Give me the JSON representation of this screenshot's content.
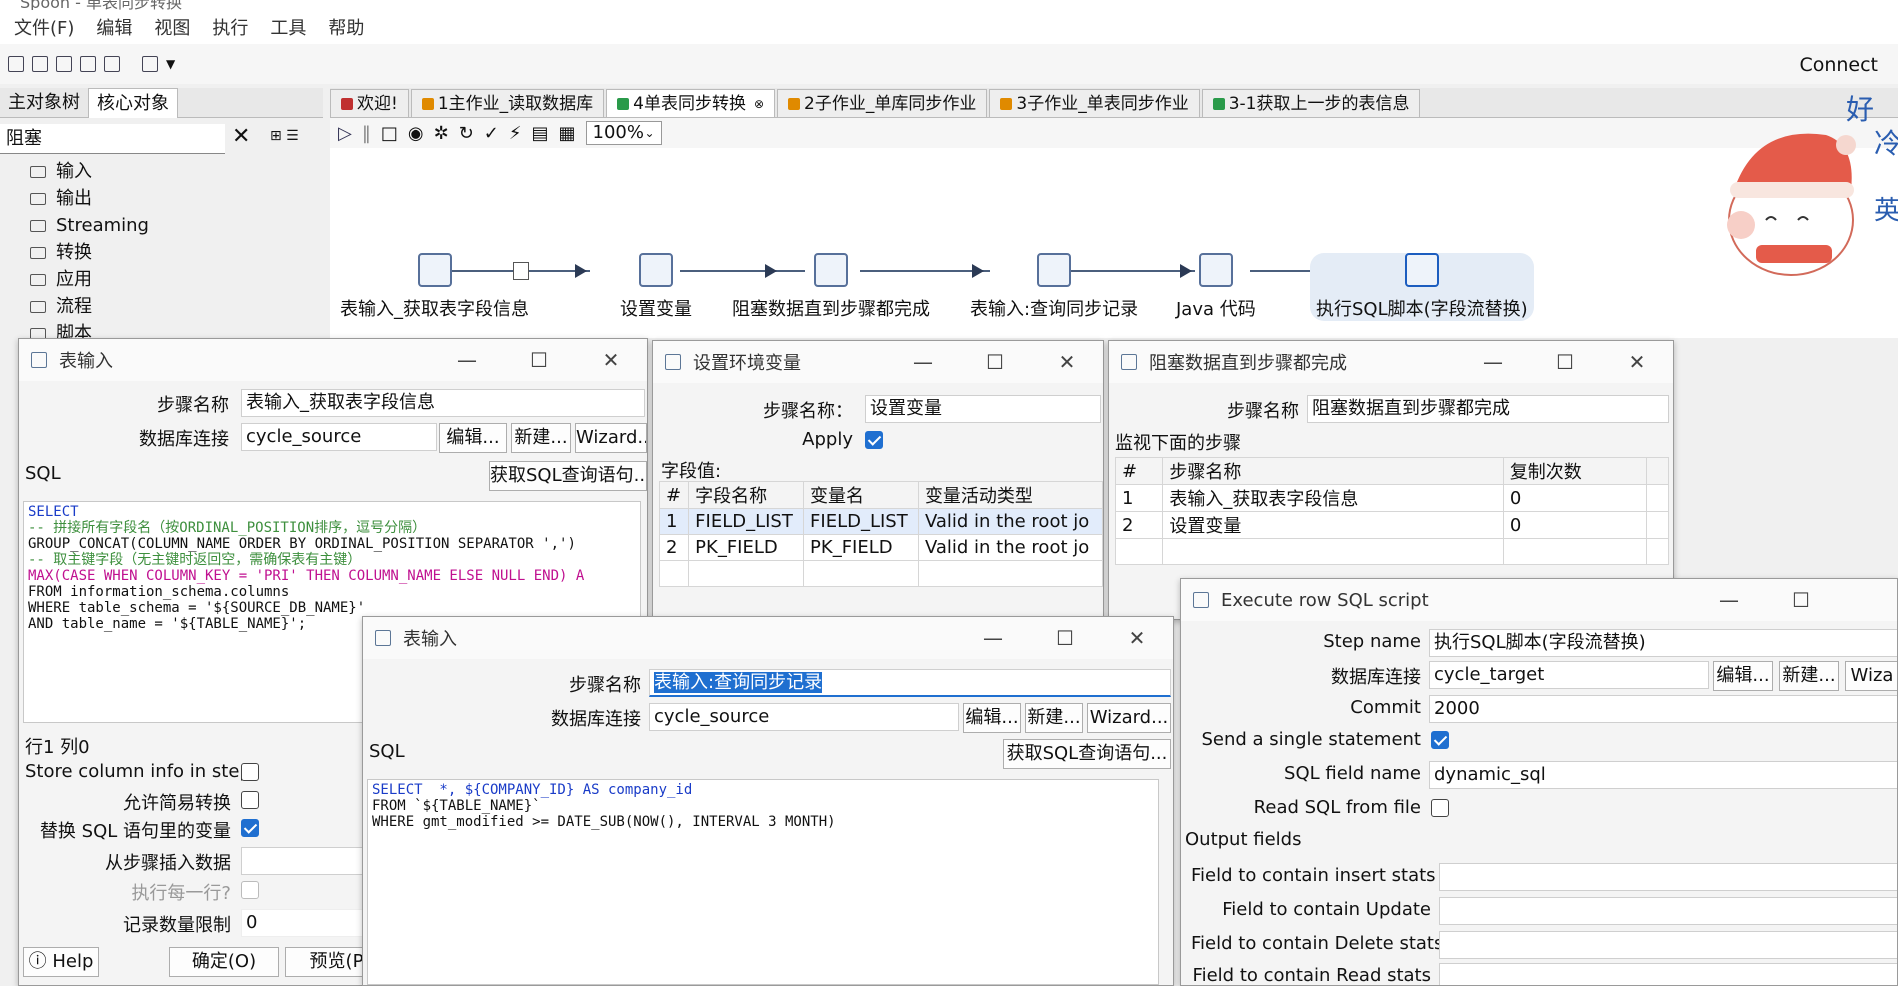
{
  "app": {
    "title": "Spoon - 单表同步转换",
    "connect_label": "Connect"
  },
  "menu": [
    "文件(F)",
    "编辑",
    "视图",
    "执行",
    "工具",
    "帮助"
  ],
  "left_panel": {
    "tabs": [
      "主对象树",
      "核心对象"
    ],
    "search_value": "阻塞",
    "tree": [
      "输入",
      "输出",
      "Streaming",
      "转换",
      "应用",
      "流程",
      "脚本"
    ]
  },
  "tabs": [
    {
      "label": "欢迎!",
      "color": "#c03030"
    },
    {
      "label": "1主作业_读取数据库",
      "color": "#e08a00"
    },
    {
      "label": "4单表同步转换",
      "color": "#2a9a4a"
    },
    {
      "label": "2子作业_单库同步作业",
      "color": "#e08a00"
    },
    {
      "label": "3子作业_单表同步作业",
      "color": "#e08a00"
    },
    {
      "label": "3-1获取上一步的表信息",
      "color": "#2a9a4a"
    }
  ],
  "canvas": {
    "zoom": "100%",
    "nodes": [
      "表输入_获取表字段信息",
      "设置变量",
      "阻塞数据直到步骤都完成",
      "表输入:查询同步记录",
      "Java 代码",
      "执行SQL脚本(字段流替换)"
    ]
  },
  "dialog1": {
    "title": "表输入",
    "step_name_label": "步骤名称",
    "step_name": "表输入_获取表字段信息",
    "conn_label": "数据库连接",
    "conn": "cycle_source",
    "edit_btn": "编辑...",
    "new_btn": "新建...",
    "wizard_btn": "Wizard...",
    "sql_label": "SQL",
    "get_sql_btn": "获取SQL查询语句...",
    "sql_lines": [
      "SELECT",
      "-- 拼接所有字段名（按ORDINAL_POSITION排序，逗号分隔）",
      "GROUP_CONCAT(COLUMN_NAME ORDER BY ORDINAL_POSITION SEPARATOR ',')",
      "-- 取主键字段（无主键时返回空，需确保表有主键）",
      "MAX(CASE WHEN COLUMN_KEY = 'PRI' THEN COLUMN_NAME ELSE NULL END) A",
      "FROM information_schema.columns",
      "WHERE table_schema = '${SOURCE_DB_NAME}'",
      "AND table_name = '${TABLE_NAME}';"
    ],
    "pos_text": "行1 列0",
    "store_col_label": "Store column info in step",
    "lazy_label": "允许简易转换",
    "replace_var_label": "替换 SQL 语句里的变量",
    "insert_from_label": "从步骤插入数据",
    "exec_each_label": "执行每一行?",
    "limit_label": "记录数量限制",
    "limit_value": "0",
    "help_btn": "Help",
    "ok_btn": "确定(O)",
    "preview_btn": "预览(P)"
  },
  "dialog2": {
    "title": "设置环境变量",
    "step_name_label": "步骤名称：",
    "step_name": "设置变量",
    "apply_label": "Apply",
    "fields_label": "字段值:",
    "columns": [
      "#",
      "字段名称",
      "变量名",
      "变量活动类型"
    ],
    "rows": [
      [
        "1",
        "FIELD_LIST",
        "FIELD_LIST",
        "Valid in the root jo"
      ],
      [
        "2",
        "PK_FIELD",
        "PK_FIELD",
        "Valid in the root jo"
      ]
    ]
  },
  "dialog3": {
    "title": "阻塞数据直到步骤都完成",
    "step_name_label": "步骤名称",
    "step_name": "阻塞数据直到步骤都完成",
    "watch_label": "监视下面的步骤",
    "columns": [
      "#",
      "步骤名称",
      "复制次数"
    ],
    "rows": [
      [
        "1",
        "表输入_获取表字段信息",
        "0"
      ],
      [
        "2",
        "设置变量",
        "0"
      ]
    ]
  },
  "dialog4": {
    "title": "Execute row SQL script",
    "step_name_label": "Step name",
    "step_name": "执行SQL脚本(字段流替换)",
    "conn_label": "数据库连接",
    "conn": "cycle_target",
    "edit_btn": "编辑...",
    "new_btn": "新建...",
    "wizard_btn": "Wiza",
    "commit_label": "Commit",
    "commit": "2000",
    "single_label": "Send a single statement",
    "sql_field_label": "SQL field name",
    "sql_field": "dynamic_sql",
    "read_file_label": "Read SQL from file",
    "output_label": "Output fields",
    "insert_label": "Field to contain insert stats",
    "update_label": "Field to contain Update",
    "delete_label": "Field to contain Delete stats",
    "read_label": "Field to contain Read stats"
  },
  "dialog5": {
    "title": "表输入",
    "step_name_label": "步骤名称",
    "step_name": "表输入:查询同步记录",
    "conn_label": "数据库连接",
    "conn": "cycle_source",
    "edit_btn": "编辑...",
    "new_btn": "新建...",
    "wizard_btn": "Wizard...",
    "sql_label": "SQL",
    "get_sql_btn": "获取SQL查询语句...",
    "sql_lines": [
      "SELECT  *, ${COMPANY_ID} AS company_id",
      "FROM `${TABLE_NAME}`",
      "WHERE gmt_modified >= DATE_SUB(NOW(), INTERVAL 3 MONTH)"
    ]
  },
  "mascot": {
    "text1": "好",
    "text2": "冷",
    "text3": "英"
  }
}
